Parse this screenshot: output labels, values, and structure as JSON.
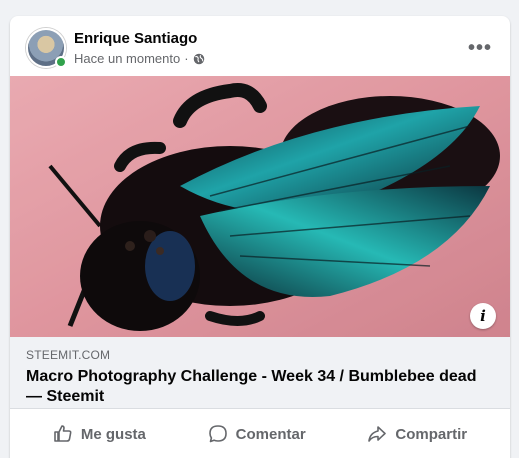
{
  "post": {
    "author": "Enrique Santiago",
    "timestamp": "Hace un momento",
    "separator": "·",
    "privacy_icon": "globe-icon",
    "more_icon": "more-options-icon",
    "more_label": "•••"
  },
  "link_preview": {
    "domain": "STEEMIT.COM",
    "title": "Macro Photography Challenge - Week 34 / Bumblebee dead — Steemit",
    "info_label": "i"
  },
  "actions": {
    "like": "Me gusta",
    "comment": "Comentar",
    "share": "Compartir"
  },
  "colors": {
    "primary_text": "#050505",
    "secondary_text": "#65676b",
    "online": "#31a24c",
    "background": "#f0f2f5"
  }
}
